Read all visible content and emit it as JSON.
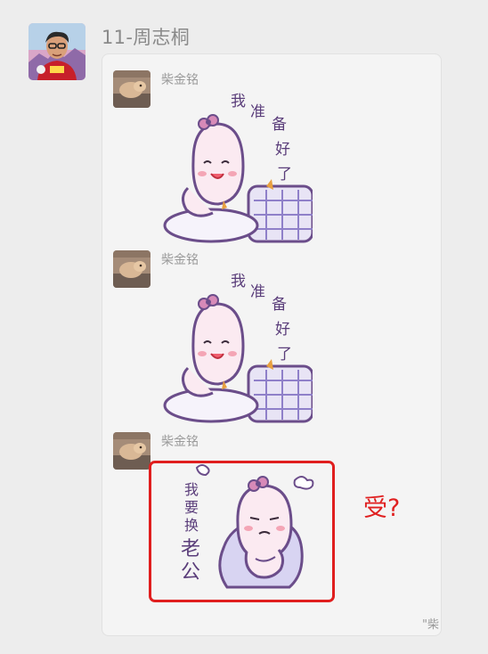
{
  "chat": {
    "sender_title": "11-周志桐",
    "messages": [
      {
        "name": "柴金铭",
        "sticker_text": [
          "我",
          "准",
          "备",
          "好",
          "了"
        ]
      },
      {
        "name": "柴金铭",
        "sticker_text": [
          "我",
          "准",
          "备",
          "好",
          "了"
        ]
      },
      {
        "name": "柴金铭",
        "sticker_text": [
          "我",
          "要",
          "换",
          "老",
          "公"
        ]
      }
    ],
    "annotation": "受?",
    "footer_tag": "\"柴"
  },
  "colors": {
    "highlight": "#e01e1e",
    "annotation": "#e02020",
    "sticker_outline": "#6b4d8a",
    "sticker_face": "#fbeaf1"
  }
}
